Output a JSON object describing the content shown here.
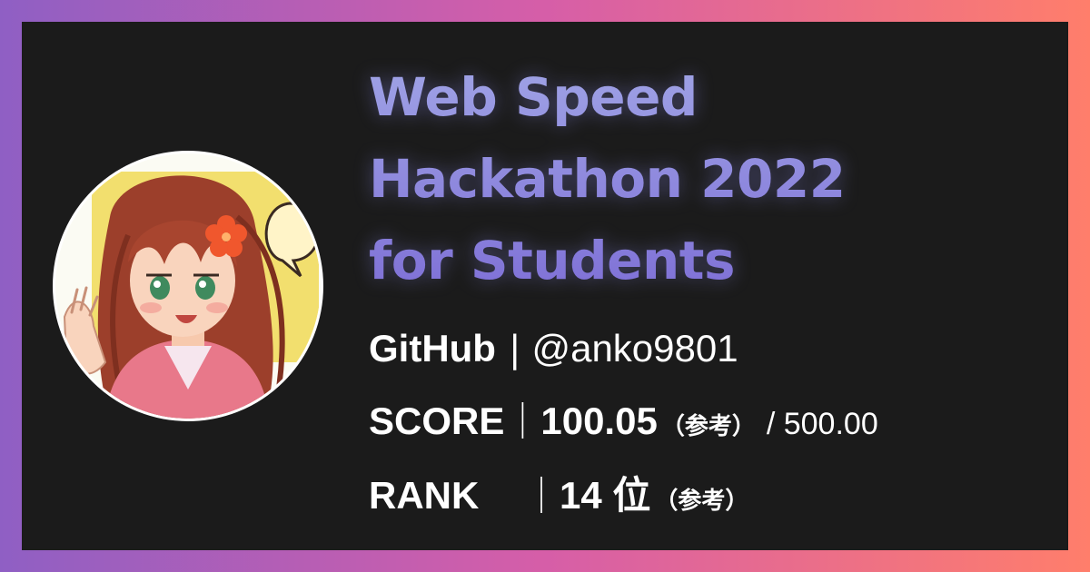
{
  "title": {
    "line1": "Web Speed",
    "line2": "Hackathon 2022",
    "line3": "for Students"
  },
  "stats": {
    "github": {
      "label": "GitHub",
      "separator": "|",
      "value": "@anko9801"
    },
    "score": {
      "label": "SCORE",
      "separator": "｜",
      "value": "100.05",
      "note": "（参考）",
      "total": "/ 500.00"
    },
    "rank": {
      "label": "RANK",
      "separator": "｜",
      "value": "14 位",
      "note": "（参考）"
    }
  },
  "colors": {
    "frame_gradient": [
      "#8f5fc4",
      "#d65ea8",
      "#ff7e6b"
    ],
    "card_background": "#1b1b1b",
    "title_color": "#8b86d8",
    "text_color": "#ffffff"
  },
  "avatar": {
    "icon": "anime-character-avatar"
  }
}
